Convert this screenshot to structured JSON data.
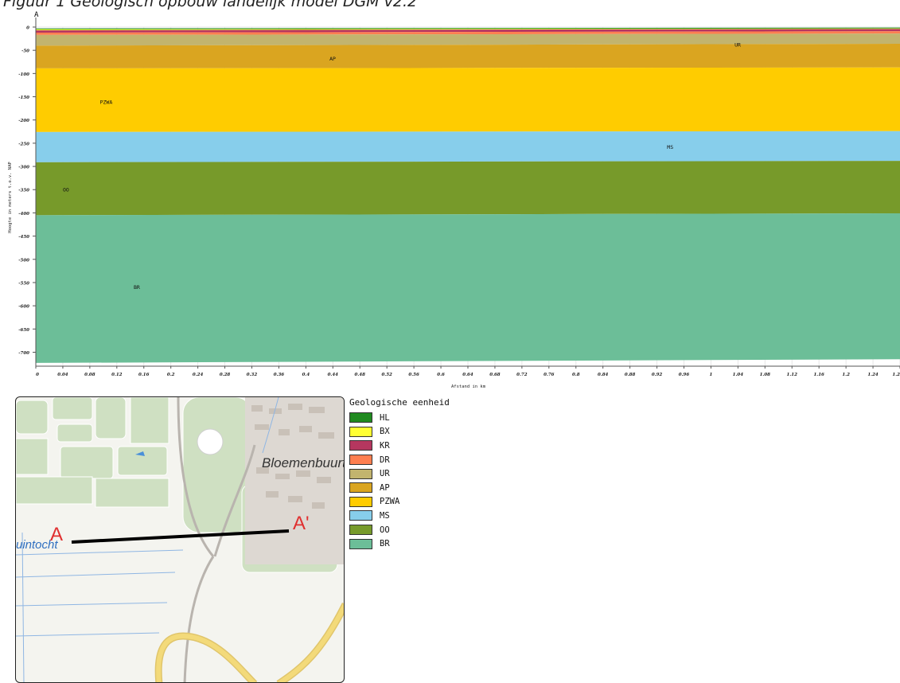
{
  "figure": {
    "title": "Figuur 1 Geologisch opbouw landelijk model DGM v2.2",
    "section_start_label": "A"
  },
  "chart_data": {
    "type": "area",
    "title": "",
    "xlabel": "Afstand in km",
    "ylabel": "Hoogte in meters t.o.v. NAP",
    "xlim": [
      0,
      1.28
    ],
    "ylim": [
      -730,
      0
    ],
    "x_ticks": [
      0,
      0.04,
      0.08,
      0.12,
      0.16,
      0.2,
      0.24,
      0.28,
      0.32,
      0.36,
      0.4,
      0.44,
      0.48,
      0.52,
      0.56,
      0.6,
      0.64,
      0.68,
      0.72,
      0.76,
      0.8,
      0.84,
      0.88,
      0.92,
      0.96,
      1,
      1.04,
      1.08,
      1.12,
      1.16,
      1.2,
      1.24,
      1.28
    ],
    "x_tick_labels": [
      "0",
      "0.04",
      "0.08",
      "0.12",
      "0.16",
      "0.2",
      "0.24",
      "0.28",
      "0.32",
      "0.36",
      "0.4",
      "0.44",
      "0.48",
      "0.52",
      "0.56",
      "0.6",
      "0.64",
      "0.68",
      "0.72",
      "0.76",
      "0.8",
      "0.84",
      "0.88",
      "0.92",
      "0.96",
      "1",
      "1.04",
      "1.08",
      "1.12",
      "1.16",
      "1.2",
      "1.24",
      "1.2"
    ],
    "y_ticks": [
      0,
      -50,
      -100,
      -150,
      -200,
      -250,
      -300,
      -350,
      -400,
      -450,
      -500,
      -550,
      -600,
      -650,
      -700
    ],
    "grid": true,
    "x": [
      0,
      1.28
    ],
    "series": [
      {
        "name": "HL",
        "color": "#1f8a1f",
        "top": [
          -3,
          -1
        ],
        "bottom": [
          -5,
          -3
        ]
      },
      {
        "name": "BX",
        "color": "#ffff33",
        "top": [
          -5,
          -3
        ],
        "bottom": [
          -7,
          -4
        ]
      },
      {
        "name": "KR",
        "color": "#b5375f",
        "top": [
          -7,
          -4
        ],
        "bottom": [
          -12,
          -9
        ]
      },
      {
        "name": "DR",
        "color": "#ff7f50",
        "top": [
          -12,
          -9
        ],
        "bottom": [
          -17,
          -14
        ]
      },
      {
        "name": "UR",
        "color": "#c2b46e",
        "top": [
          -17,
          -14
        ],
        "bottom": [
          -40,
          -36
        ]
      },
      {
        "name": "AP",
        "color": "#daa520",
        "top": [
          -40,
          -36
        ],
        "bottom": [
          -89,
          -87
        ]
      },
      {
        "name": "PZWA",
        "color": "#ffcc00",
        "top": [
          -89,
          -87
        ],
        "bottom": [
          -226,
          -224
        ]
      },
      {
        "name": "MS",
        "color": "#87ceeb",
        "top": [
          -226,
          -224
        ],
        "bottom": [
          -291,
          -288
        ]
      },
      {
        "name": "OO",
        "color": "#779a2a",
        "top": [
          -291,
          -288
        ],
        "bottom": [
          -405,
          -401
        ]
      },
      {
        "name": "BR",
        "color": "#6cbe98",
        "top": [
          -405,
          -401
        ],
        "bottom": [
          -723,
          -715
        ]
      }
    ],
    "layer_labels": [
      {
        "text": "UR",
        "x": 1.035,
        "y": -42
      },
      {
        "text": "AP",
        "x": 0.435,
        "y": -72
      },
      {
        "text": "PZWA",
        "x": 0.095,
        "y": -165
      },
      {
        "text": "MS",
        "x": 0.935,
        "y": -262
      },
      {
        "text": "OO",
        "x": 0.04,
        "y": -354
      },
      {
        "text": "BR",
        "x": 0.145,
        "y": -564
      }
    ]
  },
  "legend": {
    "title": "Geologische eenheid",
    "items": [
      {
        "label": "HL",
        "color": "#1f8a1f"
      },
      {
        "label": "BX",
        "color": "#ffff33"
      },
      {
        "label": "KR",
        "color": "#b5375f"
      },
      {
        "label": "DR",
        "color": "#ff7f50"
      },
      {
        "label": "UR",
        "color": "#c2b46e"
      },
      {
        "label": "AP",
        "color": "#daa520"
      },
      {
        "label": "PZWA",
        "color": "#ffcc00"
      },
      {
        "label": "MS",
        "color": "#87ceeb"
      },
      {
        "label": "OO",
        "color": "#779a2a"
      },
      {
        "label": "BR",
        "color": "#6cbe98"
      }
    ]
  },
  "map": {
    "place_label": "Bloemenbuurt",
    "water_label": "uintocht",
    "point_a_label": "A",
    "point_a_prime_label": "A'",
    "marker_color": "#e03030",
    "road_color": "#f3da7a",
    "water_color": "#4a90d9"
  }
}
